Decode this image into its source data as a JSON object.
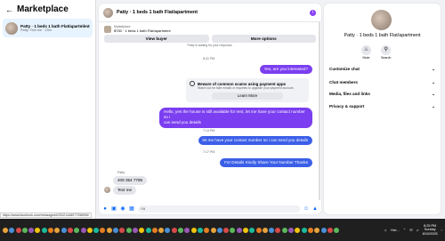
{
  "left": {
    "back_icon": "arrow-left-icon",
    "title": "Marketplace",
    "conversation": {
      "name": "Patty · 1 beds 1 bath Flat/apartment",
      "preview": "Patty: Text me · 23m"
    }
  },
  "center": {
    "header": {
      "name": "Patty · 1 beds 1 bath Flat/apartment",
      "info_icon": "info-icon"
    },
    "listing": {
      "seller": "Marketplace",
      "title": "$750 · 1 beds 1 bath Flat/apartment",
      "view_buyer": "View buyer",
      "more_options": "More options",
      "note": "Patty is waiting for your response."
    },
    "messages": {
      "ts1": "8:41 PM",
      "out1": "Yes, are you interested?",
      "scam_title": "Beware of common scams using payment apps",
      "scam_desc": "Watch out for fake emails or requests to upgrade your payment account.",
      "scam_button": "Learn More",
      "out2_line1": "Hello, yes the house is still available for rent, let me have your contact number so i",
      "out2_line2": "can send you details",
      "ts2": "7:14 PM",
      "out3": "let me have your contact number so i can send you details",
      "ts3": "7:17 PM",
      "out4": "For  Details Kindly Share Your Number Thanks",
      "sender": "Patty",
      "in1": "409 354 7785",
      "in2": "Text me"
    },
    "input": {
      "placeholder": "Aa"
    }
  },
  "right": {
    "name": "Patty · 1 beds 1 bath Flat/apartment",
    "mute": "Mute",
    "search": "Search",
    "sections": [
      "Customize chat",
      "Chat members",
      "Media, files and links",
      "Privacy & support"
    ]
  },
  "status_url": "https://www.facebook.com/messages/t/25321448977258906/",
  "taskbar": {
    "weather": "Hot...",
    "time": "8:25 PM",
    "day": "Sunday",
    "date": "8/10/2025"
  },
  "colors": {
    "accent": "#7b3ef0",
    "blue": "#3b5fe8",
    "link": "#0866ff"
  }
}
